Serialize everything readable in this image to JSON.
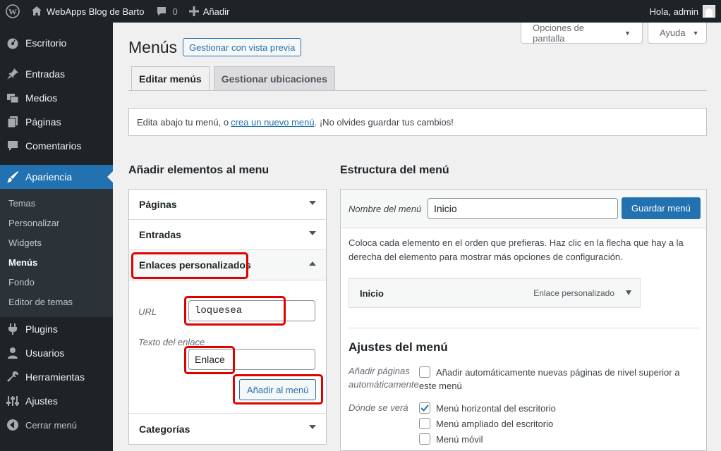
{
  "adminbar": {
    "site_name": "WebApps Blog de Barto",
    "comments_count": "0",
    "new_label": "Añadir",
    "greeting": "Hola, admin"
  },
  "sidebar": {
    "items": [
      {
        "label": "Escritorio",
        "icon": "dashboard-icon"
      },
      {
        "label": "Entradas",
        "icon": "pin-icon"
      },
      {
        "label": "Medios",
        "icon": "media-icon"
      },
      {
        "label": "Páginas",
        "icon": "pages-icon"
      },
      {
        "label": "Comentarios",
        "icon": "comments-icon"
      },
      {
        "label": "Apariencia",
        "icon": "brush-icon"
      },
      {
        "label": "Plugins",
        "icon": "plugin-icon"
      },
      {
        "label": "Usuarios",
        "icon": "users-icon"
      },
      {
        "label": "Herramientas",
        "icon": "tools-icon"
      },
      {
        "label": "Ajustes",
        "icon": "settings-icon"
      },
      {
        "label": "Cerrar menú",
        "icon": "collapse-icon"
      }
    ],
    "submenu": [
      "Temas",
      "Personalizar",
      "Widgets",
      "Menús",
      "Fondo",
      "Editor de temas"
    ]
  },
  "screen_options": {
    "options_label": "Opciones de pantalla",
    "help_label": "Ayuda"
  },
  "page": {
    "title": "Menús",
    "preview_button": "Gestionar con vista previa",
    "tabs": [
      "Editar menús",
      "Gestionar ubicaciones"
    ]
  },
  "notice": {
    "before": "Edita abajo tu menú, o",
    "link": "crea un nuevo menú",
    "after": ". ¡No olvides guardar tus cambios!"
  },
  "add_items": {
    "title": "Añadir elementos al menu",
    "sections": [
      "Páginas",
      "Entradas",
      "Enlaces personalizados",
      "Categorías"
    ],
    "url_label": "URL",
    "url_value": "loquesea",
    "text_label": "Texto del enlace",
    "text_value": "Enlace",
    "add_button": "Añadir al menú"
  },
  "structure": {
    "title": "Estructura del menú",
    "name_label": "Nombre del menú",
    "name_value": "Inicio",
    "save_button": "Guardar menú",
    "description": "Coloca cada elemento en el orden que prefieras. Haz clic en la flecha que hay a la derecha del elemento para mostrar más opciones de configuración.",
    "menu_item": {
      "title": "Inicio",
      "type": "Enlace personalizado"
    },
    "settings_title": "Ajustes del menú",
    "auto_add_label_1": "Añadir páginas",
    "auto_add_label_2": "automáticamente",
    "auto_add_text_1": "Añadir automáticamente nuevas páginas de nivel superior a",
    "auto_add_text_2": "este menú",
    "location_label": "Dónde se verá",
    "locations": [
      {
        "label": "Menú horizontal del escritorio",
        "checked": true
      },
      {
        "label": "Menú ampliado del escritorio",
        "checked": false
      },
      {
        "label": "Menú móvil",
        "checked": false
      }
    ]
  },
  "colors": {
    "accent": "#2271b1",
    "highlight": "#e00000",
    "sidebar": "#1d2327"
  }
}
